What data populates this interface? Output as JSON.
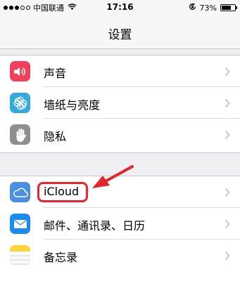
{
  "status_bar": {
    "carrier": "中国联通",
    "time": "17:16",
    "battery": "73%",
    "battery_level": 0.73,
    "signal_bars": 3
  },
  "nav": {
    "title": "设置"
  },
  "groups": [
    {
      "items": [
        {
          "label": "声音",
          "icon": "sound-icon",
          "color": "#f0415c"
        },
        {
          "label": "墙纸与亮度",
          "icon": "wallpaper-icon",
          "color": "#34aadc"
        },
        {
          "label": "隐私",
          "icon": "privacy-hand-icon",
          "color": "#8e8e93"
        }
      ]
    },
    {
      "items": [
        {
          "label": "iCloud",
          "icon": "icloud-icon",
          "color": "#4a90e2"
        },
        {
          "label": "邮件、通讯录、日历",
          "icon": "mail-icon",
          "color": "#1a8cf0"
        },
        {
          "label": "备忘录",
          "icon": "notes-icon",
          "color": "#fdd43a"
        }
      ]
    }
  ],
  "colors": {
    "annotation": "#e8232a",
    "background": "#efeff4"
  }
}
